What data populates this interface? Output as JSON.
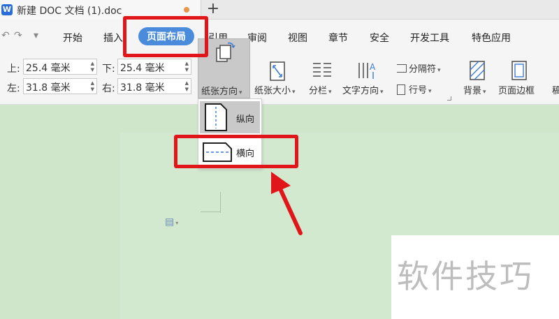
{
  "titlebar": {
    "app_logo": "W",
    "doc_title": "新建 DOC 文档 (1).doc",
    "new_tab": "+"
  },
  "quick_access": {
    "undo": "↶",
    "redo": "↷",
    "more": "▾"
  },
  "menu": {
    "items": [
      "开始",
      "插入",
      "页面布局",
      "引用",
      "审阅",
      "视图",
      "章节",
      "安全",
      "开发工具",
      "特色应用"
    ],
    "active": "页面布局"
  },
  "margins": {
    "top_label": "上:",
    "top_value": "25.4 毫米",
    "bottom_label": "下:",
    "bottom_value": "25.4 毫米",
    "left_label": "左:",
    "left_value": "31.8 毫米",
    "right_label": "右:",
    "right_value": "31.8 毫米"
  },
  "toolbar": {
    "orientation": "纸张方向",
    "paper_size": "纸张大小",
    "columns": "分栏",
    "text_direction": "文字方向",
    "separator": "分隔符",
    "line_number": "行号",
    "background": "背景",
    "page_border": "页面边框",
    "cut_off_label": "稿"
  },
  "orientation_menu": {
    "portrait": "纵向",
    "landscape": "横向"
  },
  "document": {
    "watermark": "软件技巧"
  },
  "colors": {
    "accent": "#4a8cdb",
    "annotation": "#e0161a",
    "page_bg": "#cfe6cb"
  }
}
